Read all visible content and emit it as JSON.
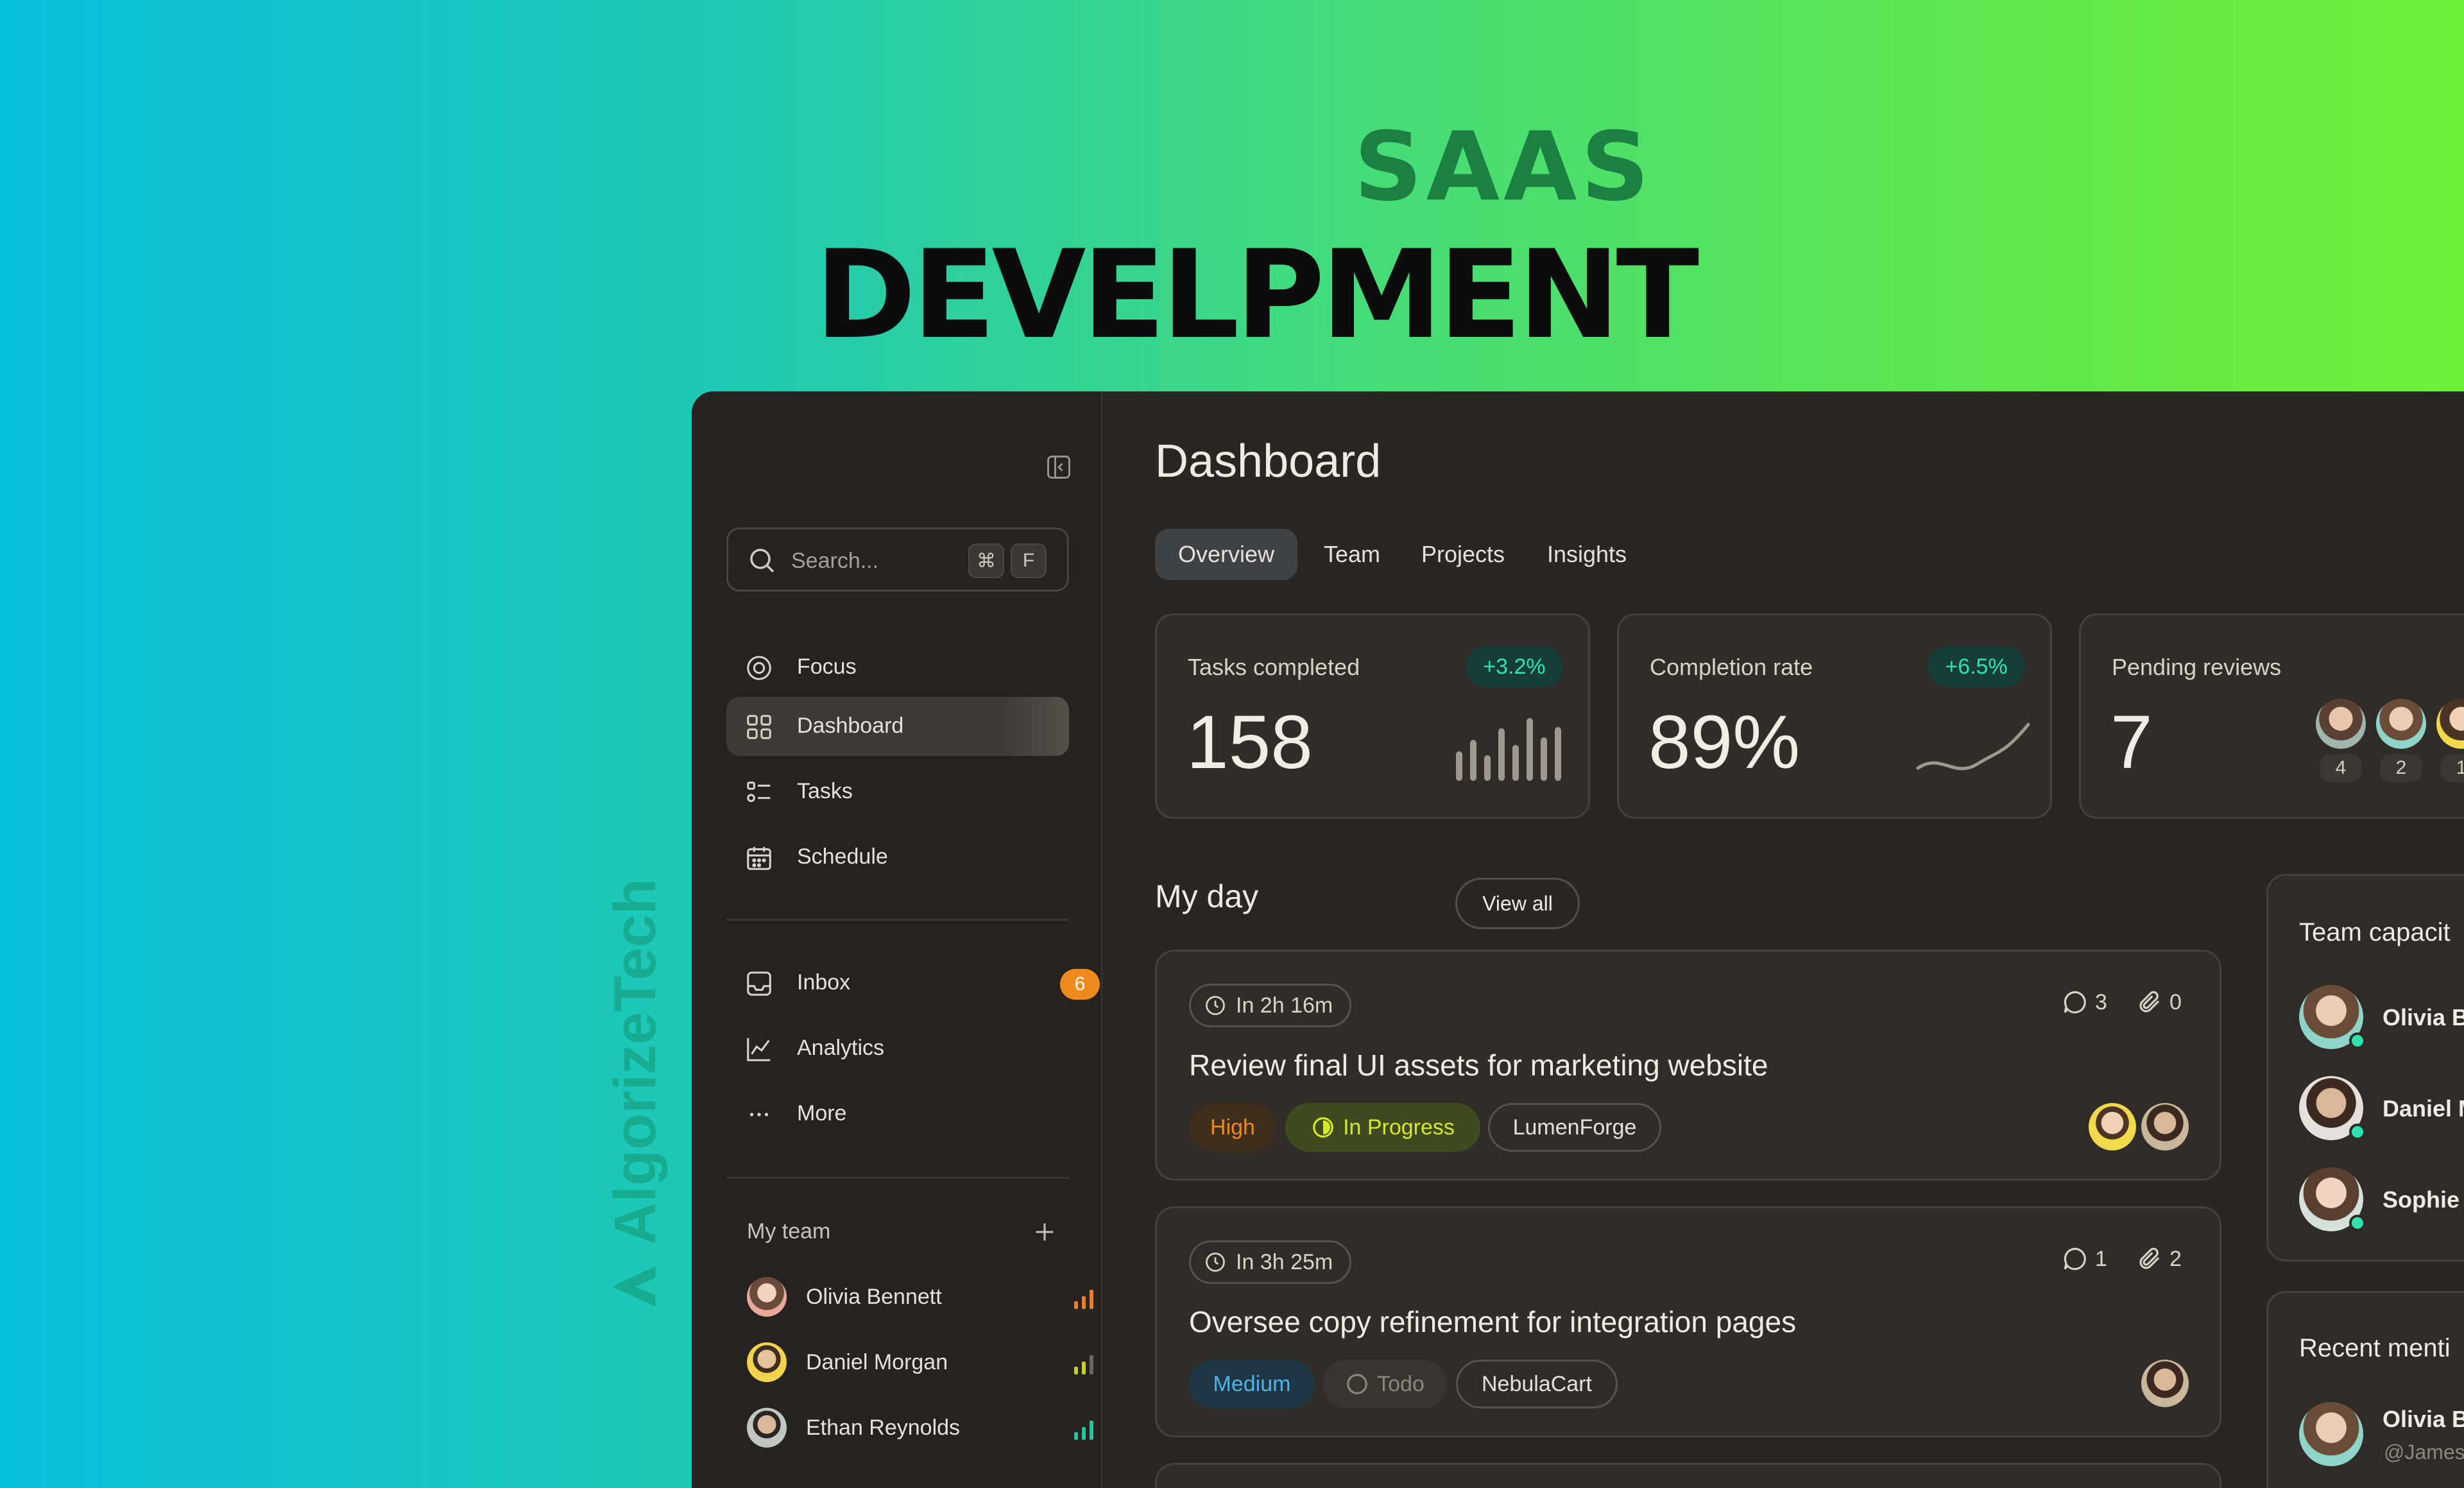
{
  "hero": {
    "line1": "SAAS",
    "line2": "DEVELPMENT"
  },
  "watermark": {
    "brand": "AlgorizeTech"
  },
  "sidebar": {
    "search": {
      "placeholder": "Search...",
      "shortcut_mod": "⌘",
      "shortcut_key": "F"
    },
    "nav_primary": [
      {
        "label": "Focus",
        "icon": "focus-icon"
      },
      {
        "label": "Dashboard",
        "icon": "grid-icon",
        "active": true
      },
      {
        "label": "Tasks",
        "icon": "tasks-icon"
      },
      {
        "label": "Schedule",
        "icon": "calendar-icon"
      }
    ],
    "nav_secondary": [
      {
        "label": "Inbox",
        "icon": "inbox-icon",
        "badge": "6"
      },
      {
        "label": "Analytics",
        "icon": "analytics-icon"
      },
      {
        "label": "More",
        "icon": "more-icon"
      }
    ],
    "team": {
      "title": "My team",
      "members": [
        {
          "name": "Olivia Bennett",
          "bars_color": "#f57c1f"
        },
        {
          "name": "Daniel Morgan",
          "bars_color": "#c7d21b"
        },
        {
          "name": "Ethan Reynolds",
          "bars_color": "#1fc79b"
        }
      ]
    }
  },
  "main": {
    "title": "Dashboard",
    "tabs": [
      "Overview",
      "Team",
      "Projects",
      "Insights"
    ],
    "stats": [
      {
        "label": "Tasks completed",
        "value": "158",
        "change": "+3.2%"
      },
      {
        "label": "Completion rate",
        "value": "89%",
        "change": "+6.5%"
      },
      {
        "label": "Pending reviews",
        "value": "7",
        "reviewer_counts": [
          "4",
          "2",
          "1"
        ]
      }
    ],
    "my_day": {
      "title": "My day",
      "view_all": "View all",
      "tasks": [
        {
          "time": "In 2h 16m",
          "comments": "3",
          "attachments": "0",
          "title": "Review final UI assets for marketing website",
          "priority": "High",
          "status": "In Progress",
          "project": "LumenForge"
        },
        {
          "time": "In 3h 25m",
          "comments": "1",
          "attachments": "2",
          "title": "Oversee copy refinement for integration pages",
          "priority": "Medium",
          "status": "Todo",
          "project": "NebulaCart"
        }
      ]
    }
  },
  "right": {
    "team_capacity": {
      "title": "Team capacit",
      "members": [
        "Olivia B",
        "Daniel M",
        "Sophie"
      ]
    },
    "recent_mentions": {
      "title": "Recent menti",
      "member": "Olivia B",
      "handle": "@James"
    }
  },
  "colors": {
    "accent_teal": "#2fe3b0",
    "priority_high": "#f18a1c",
    "status_in_progress": "#d6e82a",
    "priority_medium": "#4cb4e6",
    "badge_orange": "#f18a1c"
  }
}
